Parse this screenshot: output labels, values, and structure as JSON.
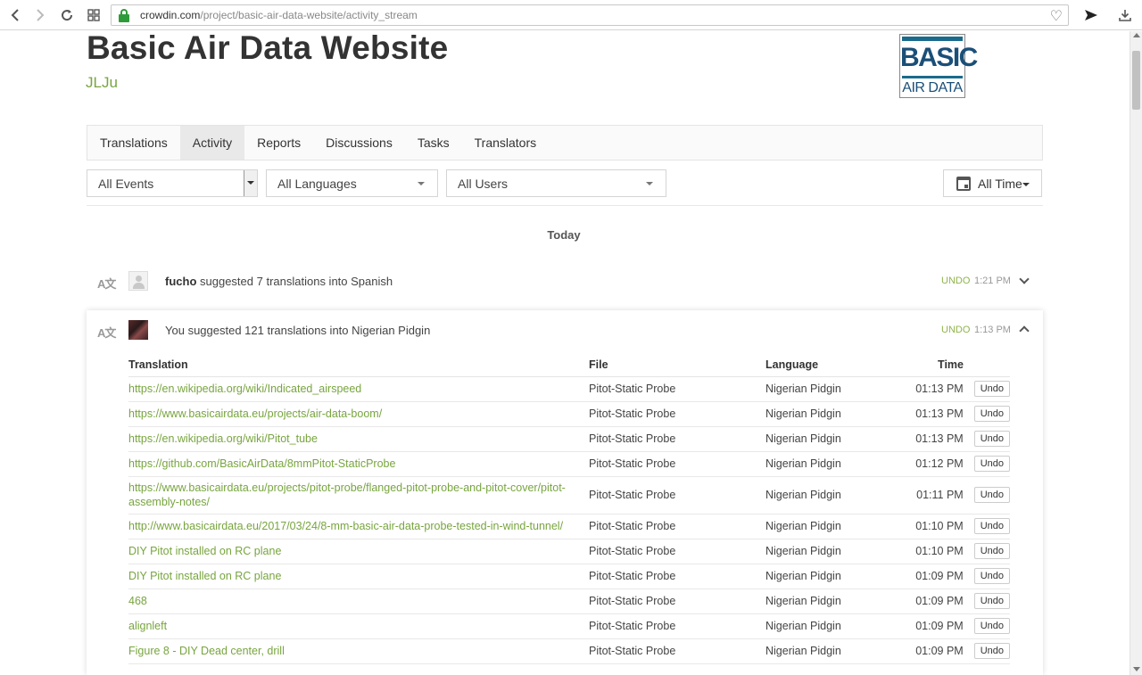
{
  "browser": {
    "url_domain": "crowdin.com",
    "url_path": "/project/basic-air-data-website/activity_stream"
  },
  "header": {
    "title": "Basic Air Data Website",
    "owner": "JLJu",
    "logo_top": "BASIC",
    "logo_bottom": "AIR DATA"
  },
  "tabs": [
    "Translations",
    "Activity",
    "Reports",
    "Discussions",
    "Tasks",
    "Translators"
  ],
  "active_tab": "Activity",
  "filters": {
    "events": "All Events",
    "languages": "All Languages",
    "users": "All Users",
    "time": "All Time"
  },
  "stream": {
    "day_label": "Today",
    "icon_glyph": "A文",
    "items": [
      {
        "user": "fucho",
        "text": "suggested 7 translations into Spanish",
        "undo": "UNDO",
        "time": "1:21 PM"
      },
      {
        "user": "You",
        "text": "suggested 121 translations into Nigerian Pidgin",
        "undo": "UNDO",
        "time": "1:13 PM"
      }
    ]
  },
  "table": {
    "headers": {
      "translation": "Translation",
      "file": "File",
      "language": "Language",
      "time": "Time"
    },
    "undo_label": "Undo",
    "rows": [
      {
        "translation": "https://en.wikipedia.org/wiki/Indicated_airspeed",
        "file": "Pitot-Static Probe",
        "language": "Nigerian Pidgin",
        "time": "01:13 PM"
      },
      {
        "translation": "https://www.basicairdata.eu/projects/air-data-boom/",
        "file": "Pitot-Static Probe",
        "language": "Nigerian Pidgin",
        "time": "01:13 PM"
      },
      {
        "translation": "https://en.wikipedia.org/wiki/Pitot_tube",
        "file": "Pitot-Static Probe",
        "language": "Nigerian Pidgin",
        "time": "01:13 PM"
      },
      {
        "translation": "https://github.com/BasicAirData/8mmPitot-StaticProbe",
        "file": "Pitot-Static Probe",
        "language": "Nigerian Pidgin",
        "time": "01:12 PM"
      },
      {
        "translation": "https://www.basicairdata.eu/projects/pitot-probe/flanged-pitot-probe-and-pitot-cover/pitot-assembly-notes/",
        "file": "Pitot-Static Probe",
        "language": "Nigerian Pidgin",
        "time": "01:11 PM"
      },
      {
        "translation": "http://www.basicairdata.eu/2017/03/24/8-mm-basic-air-data-probe-tested-in-wind-tunnel/",
        "file": "Pitot-Static Probe",
        "language": "Nigerian Pidgin",
        "time": "01:10 PM"
      },
      {
        "translation": "DIY Pitot installed on RC plane",
        "file": "Pitot-Static Probe",
        "language": "Nigerian Pidgin",
        "time": "01:10 PM"
      },
      {
        "translation": "DIY Pitot installed on RC plane",
        "file": "Pitot-Static Probe",
        "language": "Nigerian Pidgin",
        "time": "01:09 PM"
      },
      {
        "translation": "468",
        "file": "Pitot-Static Probe",
        "language": "Nigerian Pidgin",
        "time": "01:09 PM"
      },
      {
        "translation": "alignleft",
        "file": "Pitot-Static Probe",
        "language": "Nigerian Pidgin",
        "time": "01:09 PM"
      },
      {
        "translation": "Figure 8 - DIY Dead center, drill",
        "file": "Pitot-Static Probe",
        "language": "Nigerian Pidgin",
        "time": "01:09 PM"
      }
    ]
  },
  "colors": {
    "accent_green": "#78a53f",
    "lock_green": "#2e9b3a",
    "logo_blue": "#1a4f78"
  }
}
